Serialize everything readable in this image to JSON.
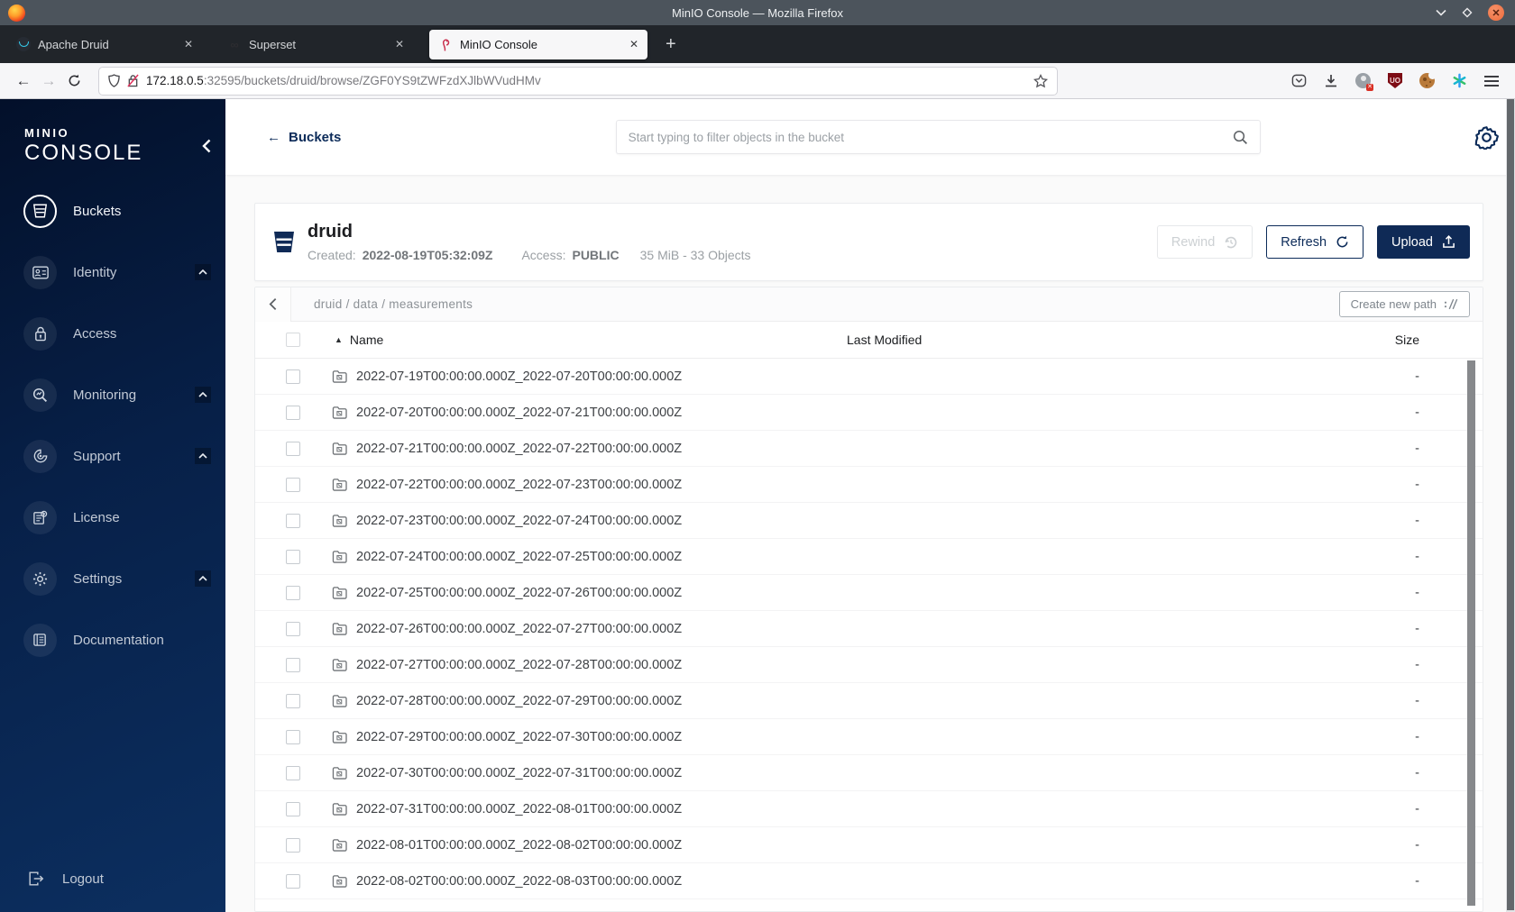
{
  "window": {
    "title": "MinIO Console — Mozilla Firefox"
  },
  "tabs": [
    {
      "label": "Apache Druid",
      "close": "✕"
    },
    {
      "label": "Superset",
      "close": "✕"
    },
    {
      "label": "MinIO Console",
      "close": "✕"
    }
  ],
  "nav": {
    "url_host": "172.18.0.5",
    "url_rest": ":32595/buckets/druid/browse/ZGF0YS9tZWFzdXJlbWVudHMv"
  },
  "sidebar": {
    "logo_small": "MINIO",
    "logo_large": "CONSOLE",
    "items": [
      {
        "label": "Buckets",
        "icon": "bucket-icon",
        "active": true,
        "expandable": false
      },
      {
        "label": "Identity",
        "icon": "id-card-icon",
        "active": false,
        "expandable": true
      },
      {
        "label": "Access",
        "icon": "lock-icon",
        "active": false,
        "expandable": false
      },
      {
        "label": "Monitoring",
        "icon": "magnifier-gauge-icon",
        "active": false,
        "expandable": true
      },
      {
        "label": "Support",
        "icon": "wrench-icon",
        "active": false,
        "expandable": true
      },
      {
        "label": "License",
        "icon": "license-document-icon",
        "active": false,
        "expandable": false
      },
      {
        "label": "Settings",
        "icon": "gear-icon",
        "active": false,
        "expandable": true
      },
      {
        "label": "Documentation",
        "icon": "book-icon",
        "active": false,
        "expandable": false
      }
    ],
    "logout_label": "Logout"
  },
  "header": {
    "back_label": "Buckets",
    "search_placeholder": "Start typing to filter objects in the bucket"
  },
  "bucket": {
    "name": "druid",
    "created_label": "Created:",
    "created_value": "2022-08-19T05:32:09Z",
    "access_label": "Access:",
    "access_value": "PUBLIC",
    "usage": "35 MiB - 33 Objects",
    "rewind_label": "Rewind",
    "refresh_label": "Refresh",
    "upload_label": "Upload"
  },
  "browse": {
    "breadcrumb": "druid / data / measurements",
    "create_path_label": "Create new path",
    "columns": {
      "name": "Name",
      "modified": "Last Modified",
      "size": "Size"
    },
    "rows": [
      {
        "name": "2022-07-19T00:00:00.000Z_2022-07-20T00:00:00.000Z",
        "size": "-"
      },
      {
        "name": "2022-07-20T00:00:00.000Z_2022-07-21T00:00:00.000Z",
        "size": "-"
      },
      {
        "name": "2022-07-21T00:00:00.000Z_2022-07-22T00:00:00.000Z",
        "size": "-"
      },
      {
        "name": "2022-07-22T00:00:00.000Z_2022-07-23T00:00:00.000Z",
        "size": "-"
      },
      {
        "name": "2022-07-23T00:00:00.000Z_2022-07-24T00:00:00.000Z",
        "size": "-"
      },
      {
        "name": "2022-07-24T00:00:00.000Z_2022-07-25T00:00:00.000Z",
        "size": "-"
      },
      {
        "name": "2022-07-25T00:00:00.000Z_2022-07-26T00:00:00.000Z",
        "size": "-"
      },
      {
        "name": "2022-07-26T00:00:00.000Z_2022-07-27T00:00:00.000Z",
        "size": "-"
      },
      {
        "name": "2022-07-27T00:00:00.000Z_2022-07-28T00:00:00.000Z",
        "size": "-"
      },
      {
        "name": "2022-07-28T00:00:00.000Z_2022-07-29T00:00:00.000Z",
        "size": "-"
      },
      {
        "name": "2022-07-29T00:00:00.000Z_2022-07-30T00:00:00.000Z",
        "size": "-"
      },
      {
        "name": "2022-07-30T00:00:00.000Z_2022-07-31T00:00:00.000Z",
        "size": "-"
      },
      {
        "name": "2022-07-31T00:00:00.000Z_2022-08-01T00:00:00.000Z",
        "size": "-"
      },
      {
        "name": "2022-08-01T00:00:00.000Z_2022-08-02T00:00:00.000Z",
        "size": "-"
      },
      {
        "name": "2022-08-02T00:00:00.000Z_2022-08-03T00:00:00.000Z",
        "size": "-"
      }
    ]
  },
  "colors": {
    "accent_navy": "#0c2b59",
    "upload_button": "#0f2a56",
    "sidebar_gradient_top": "#03102a",
    "sidebar_gradient_bottom": "#0c2f60",
    "titlebar": "#4c545c",
    "tabstrip": "#21252a",
    "ublock_red": "#7d0c15"
  }
}
